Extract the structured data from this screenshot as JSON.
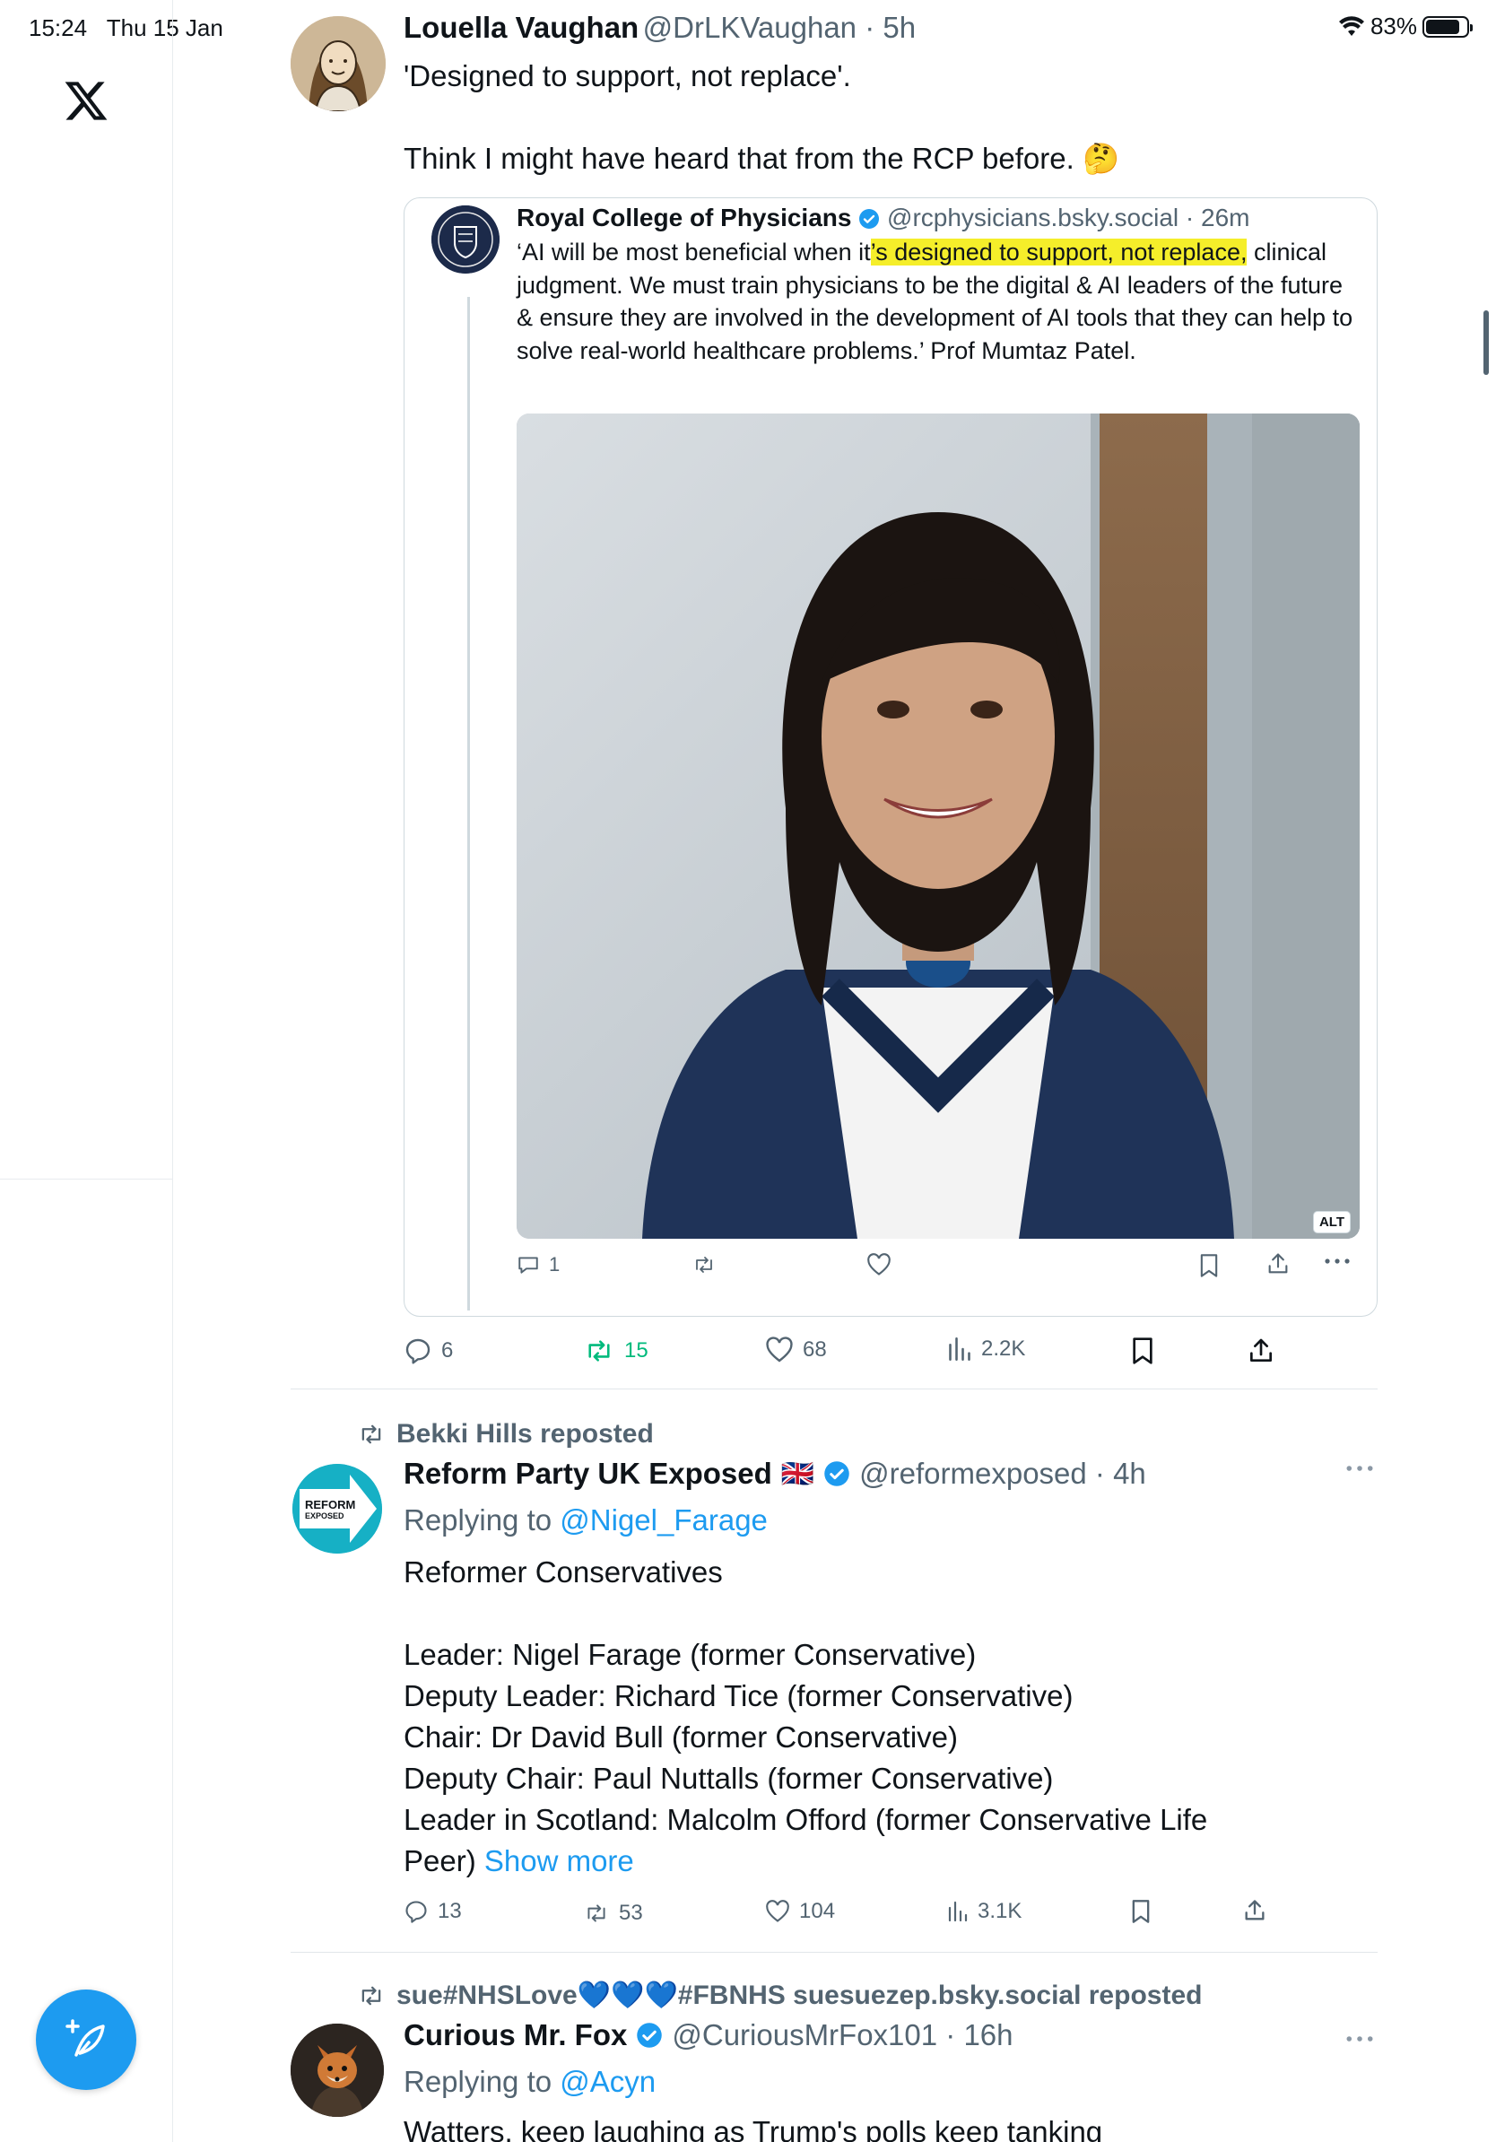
{
  "status_bar": {
    "time": "15:24",
    "date": "Thu 15 Jan",
    "battery": "83%",
    "battery_level": 0.83
  },
  "compose": {
    "label": ""
  },
  "tweets": [
    {
      "name": "Louella Vaughan",
      "handle": "@DrLKVaughan",
      "time": "5h",
      "lines": [
        "'Designed to support, not replace'.",
        "",
        "Think I might have heard that from the RCP before. 🤔"
      ],
      "quote": {
        "name": "Royal College of Physicians",
        "handle": "@rcphysicians.bsky.social",
        "time": "26m",
        "text_before": "‘AI will be most beneficial when it",
        "text_highlight": "’s designed to support, not replace,",
        "text_after": "clinical judgment. We must train physicians to be the digital & AI leaders of the future & ensure they are involved in the development of AI tools that they can help to solve real-world healthcare problems.’ Prof Mumtaz Patel.",
        "alt_badge": "ALT",
        "replies": "1"
      },
      "stats": {
        "replies": "6",
        "reposts": "15",
        "likes": "68",
        "views": "2.2K"
      }
    },
    {
      "reposted_by": "Bekki Hills reposted",
      "name": "Reform Party UK Exposed",
      "flag": "🇬🇧",
      "handle": "@reformexposed",
      "time": "4h",
      "replying_label": "Replying to",
      "replying_to": "@Nigel_Farage",
      "avatar_text_1": "REFORM",
      "avatar_text_2": "EXPOSED",
      "lines": [
        "Reformer Conservatives",
        "",
        "Leader: Nigel Farage (former Conservative)",
        "Deputy Leader: Richard Tice (former Conservative)",
        "Chair: Dr David Bull (former Conservative)",
        "Deputy Chair: Paul Nuttalls (former Conservative)",
        "Leader in Scotland: Malcolm Offord (former Conservative Life",
        "Peer)"
      ],
      "show_more": "Show more",
      "stats": {
        "replies": "13",
        "reposts": "53",
        "likes": "104",
        "views": "3.1K"
      }
    },
    {
      "reposted_by": "sue#NHSLove💙💙💙#FBNHS suesuezep.bsky.social reposted",
      "name": "Curious Mr. Fox",
      "handle": "@CuriousMrFox101",
      "time": "16h",
      "replying_label": "Replying to",
      "replying_to": "@Acyn",
      "lines": [
        "Watters, keep laughing as Trump's polls keep tanking"
      ]
    }
  ],
  "colors": {
    "accent": "#1d9bf0",
    "repost_active": "#00ba7c",
    "muted": "#536471",
    "highlight": "#f5ee2a"
  }
}
